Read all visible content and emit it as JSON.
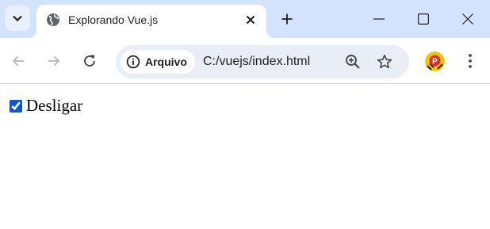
{
  "browser": {
    "tab": {
      "title": "Explorando Vue.js",
      "favicon": "globe-icon"
    },
    "address_bar": {
      "security_chip_label": "Arquivo",
      "url": "C:/vuejs/index.html"
    },
    "profile_initial": "P",
    "colors": {
      "tabstrip": "#d3e3fd",
      "omnibox": "#e9eef6",
      "icon": "#474747"
    }
  },
  "page": {
    "checkbox": {
      "label": "Desligar",
      "checked": true
    }
  }
}
